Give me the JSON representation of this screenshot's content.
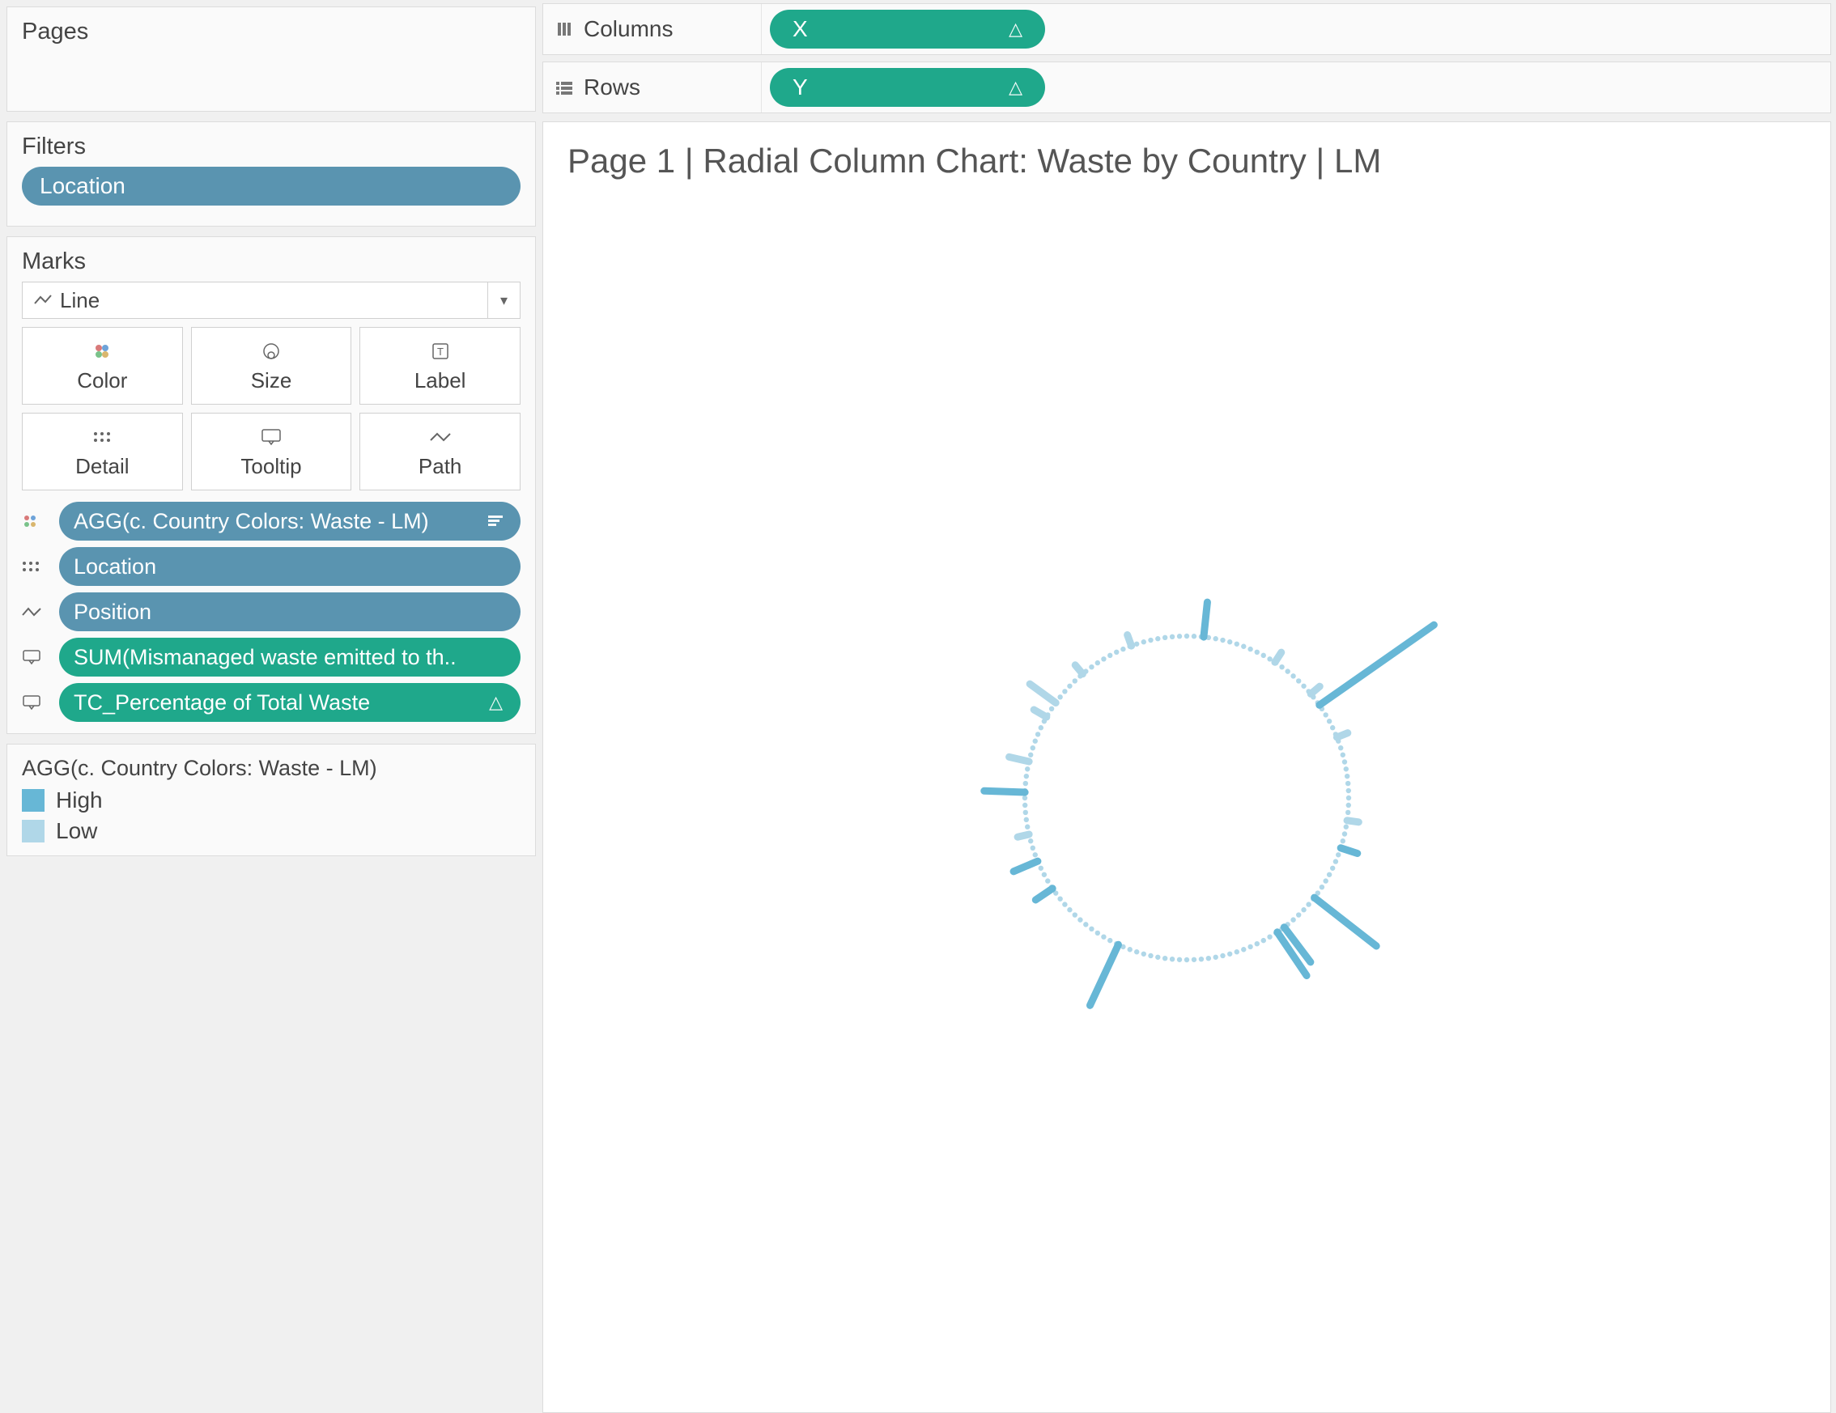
{
  "pages_card": {
    "title": "Pages"
  },
  "filters_card": {
    "title": "Filters",
    "pill": "Location"
  },
  "marks_card": {
    "title": "Marks",
    "marktype": "Line",
    "buttons": [
      "Color",
      "Size",
      "Label",
      "Detail",
      "Tooltip",
      "Path"
    ],
    "pills": [
      {
        "icon": "color",
        "label": "AGG(c. Country Colors: Waste - LM)",
        "color": "blue",
        "trailing": "menu"
      },
      {
        "icon": "detail",
        "label": "Location",
        "color": "blue"
      },
      {
        "icon": "path",
        "label": "Position",
        "color": "blue"
      },
      {
        "icon": "tooltip",
        "label": "SUM(Mismanaged waste emitted to th..",
        "color": "green"
      },
      {
        "icon": "tooltip",
        "label": "TC_Percentage of Total Waste",
        "color": "green",
        "trailing": "delta"
      }
    ]
  },
  "legend_card": {
    "title": "AGG(c. Country Colors: Waste - LM)",
    "items": [
      {
        "label": "High",
        "color": "#67b7d6"
      },
      {
        "label": "Low",
        "color": "#b0d7e8"
      }
    ]
  },
  "columns": {
    "label": "Columns",
    "pill": "X"
  },
  "rows": {
    "label": "Rows",
    "pill": "Y"
  },
  "viz": {
    "title": "Page 1 | Radial Column Chart: Waste by Country | LM"
  },
  "colors": {
    "high": "#67b7d6",
    "low": "#b0d7e8",
    "green": "#1fa88b",
    "blue": "#5a94b0"
  },
  "chart_data": {
    "type": "bar",
    "note": "Radial column chart. Approximate relative bar lengths (0–100 scale) read from the image; only visibly-tall spikes estimated. Remaining ~120 positions shown as tiny dots along the circle.",
    "inner_radius": 200,
    "n_positions": 140,
    "series": [
      {
        "name": "High",
        "color": "#67b7d6",
        "bars": [
          {
            "angle_deg": 6,
            "length": 24
          },
          {
            "angle_deg": 55,
            "length": 96
          },
          {
            "angle_deg": 108,
            "length": 12
          },
          {
            "angle_deg": 128,
            "length": 54
          },
          {
            "angle_deg": 143,
            "length": 30
          },
          {
            "angle_deg": 146,
            "length": 36
          },
          {
            "angle_deg": 205,
            "length": 46
          },
          {
            "angle_deg": 236,
            "length": 14
          },
          {
            "angle_deg": 247,
            "length": 18
          },
          {
            "angle_deg": 272,
            "length": 28
          }
        ]
      },
      {
        "name": "Low",
        "color": "#b0d7e8",
        "bars": [
          {
            "angle_deg": 33,
            "length": 8
          },
          {
            "angle_deg": 50,
            "length": 8
          },
          {
            "angle_deg": 68,
            "length": 8
          },
          {
            "angle_deg": 98,
            "length": 8
          },
          {
            "angle_deg": 257,
            "length": 8
          },
          {
            "angle_deg": 283,
            "length": 14
          },
          {
            "angle_deg": 300,
            "length": 10
          },
          {
            "angle_deg": 306,
            "length": 22
          },
          {
            "angle_deg": 320,
            "length": 8
          },
          {
            "angle_deg": 340,
            "length": 8
          }
        ]
      }
    ]
  }
}
